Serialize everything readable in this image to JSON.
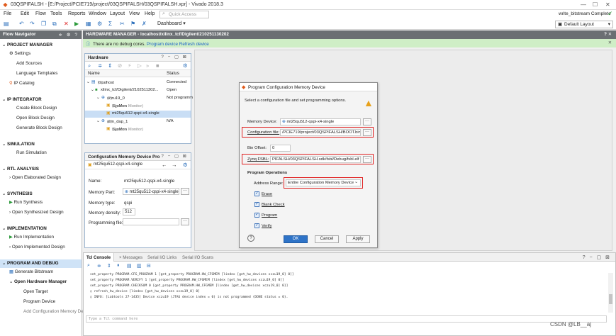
{
  "window": {
    "title": "03QSPIFALSH - [E:/Project/PCIE719/project/03QSPIFALSH/03QSPIFALSH.xpr] - Vivado 2018.3",
    "controls": [
      "—",
      "☐",
      "✕"
    ]
  },
  "menu": [
    "File",
    "Edit",
    "Flow",
    "Tools",
    "Reports",
    "Window",
    "Layout",
    "View",
    "Help"
  ],
  "quick_access_placeholder": "Quick Access",
  "status_right": "write_bitstream Complete",
  "toolbar": {
    "dashboard": "Dashboard",
    "layout": "Default Layout"
  },
  "flow_navigator": {
    "title": "Flow Navigator",
    "header_icons": "≑ ⚙ ?",
    "sections": [
      {
        "title": "PROJECT MANAGER",
        "items": [
          "Settings",
          "Add Sources",
          "Language Templates",
          "IP Catalog"
        ]
      },
      {
        "title": "IP INTEGRATOR",
        "items": [
          "Create Block Design",
          "Open Block Design",
          "Generate Block Design"
        ]
      },
      {
        "title": "SIMULATION",
        "items": [
          "Run Simulation"
        ]
      },
      {
        "title": "RTL ANALYSIS",
        "items": [
          "Open Elaborated Design"
        ]
      },
      {
        "title": "SYNTHESIS",
        "items": [
          "Run Synthesis",
          "Open Synthesized Design"
        ]
      },
      {
        "title": "IMPLEMENTATION",
        "items": [
          "Run Implementation",
          "Open Implemented Design"
        ]
      },
      {
        "title": "PROGRAM AND DEBUG",
        "items": [
          "Generate Bitstream",
          "Open Hardware Manager",
          "Open Target",
          "Program Device",
          "Add Configuration Memory Devi"
        ]
      }
    ]
  },
  "hardware_manager": {
    "title": "HARDWARE MANAGER - localhost/xilinx_tcf/Digilent/210251130202",
    "debug_msg": "There are no debug cores.",
    "link_program": "Program device",
    "link_refresh": "Refresh device"
  },
  "hardware_panel": {
    "title": "Hardware",
    "col_name": "Name",
    "col_status": "Status",
    "rows": [
      {
        "name": "localhost",
        "count": "(1)",
        "status": "Connected"
      },
      {
        "name": "xilinx_tcf/Digilent/2102511302...",
        "count": "",
        "status": "Open"
      },
      {
        "name": "xczu19_0",
        "count": "(2)",
        "status": "Not programm"
      },
      {
        "name": "SysMon",
        "count": "(System Monitor)",
        "status": ""
      },
      {
        "name": "mt25qu512-qspi-x4-single",
        "count": "",
        "status": ""
      },
      {
        "name": "arm_dap_1",
        "count": "(1)",
        "status": "N/A"
      },
      {
        "name": "SysMon",
        "count": "(System Monitor)",
        "status": ""
      }
    ]
  },
  "cmd_panel": {
    "title": "Configuration Memory Device Pro",
    "device": "mt25qu512-qspi-x4-single",
    "name_label": "Name:",
    "name_value": "mt25qu512-qspi-x4-single",
    "part_label": "Memory Part:",
    "part_value": "mt25qu512-qspi-x4-single",
    "type_label": "Memory type:",
    "type_value": "qspi",
    "density_label": "Memory density:",
    "density_value": "512",
    "progfile_label": "Programming file:"
  },
  "dialog": {
    "title": "Program Configuration Memory Device",
    "description": "Select a configuration file and set programming options.",
    "memory_device_label": "Memory Device:",
    "memory_device_value": "mt25qu512-qspi-x4-single",
    "config_file_label": "Configuration file:",
    "config_file_value": "/PCIE719/project/03QSPIFALSH/BOOT.bin",
    "bin_offset_label": "Bin Offset:",
    "bin_offset_value": "0",
    "zynq_fsbl_label": "Zynq FSBL:",
    "zynq_fsbl_value": "PIFALSH/03QSPIFALSH.sdk/fsbl/Debug/fsbl.elf",
    "program_operations": "Program Operations",
    "address_range_label": "Address Range:",
    "address_range_value": "Entire Configuration Memory Device",
    "checks": [
      "Erase",
      "Blank Check",
      "Program",
      "Verify"
    ],
    "ok": "OK",
    "cancel": "Cancel",
    "apply": "Apply"
  },
  "tcl": {
    "tabs": [
      "Tcl Console",
      "Messages",
      "Serial I/O Links",
      "Serial I/O Scans"
    ],
    "lines": [
      "set_property PROGRAM.CFG_PROGRAM 1 [get_property PROGRAM.HW_CFGMEM [lindex [get_hw_devices xczu19_0] 0]]",
      "set_property PROGRAM.VERIFY 1 [get_property PROGRAM.HW_CFGMEM [lindex [get_hw_devices xczu19_0] 0]]",
      "set_property PROGRAM.CHECKSUM 0 [get_property PROGRAM.HW_CFGMEM [lindex [get_hw_devices xczu19_0] 0]]",
      "refresh_hw_device [lindex [get_hw_devices xczu19_0] 0]",
      "INFO: [Labtools 27-1435] Device xczu19 (JTAG device index = 0) is not programmed (DONE status = 0)."
    ],
    "input_placeholder": "Type a Tcl command here"
  },
  "watermark": "CSDN @LB__aj"
}
